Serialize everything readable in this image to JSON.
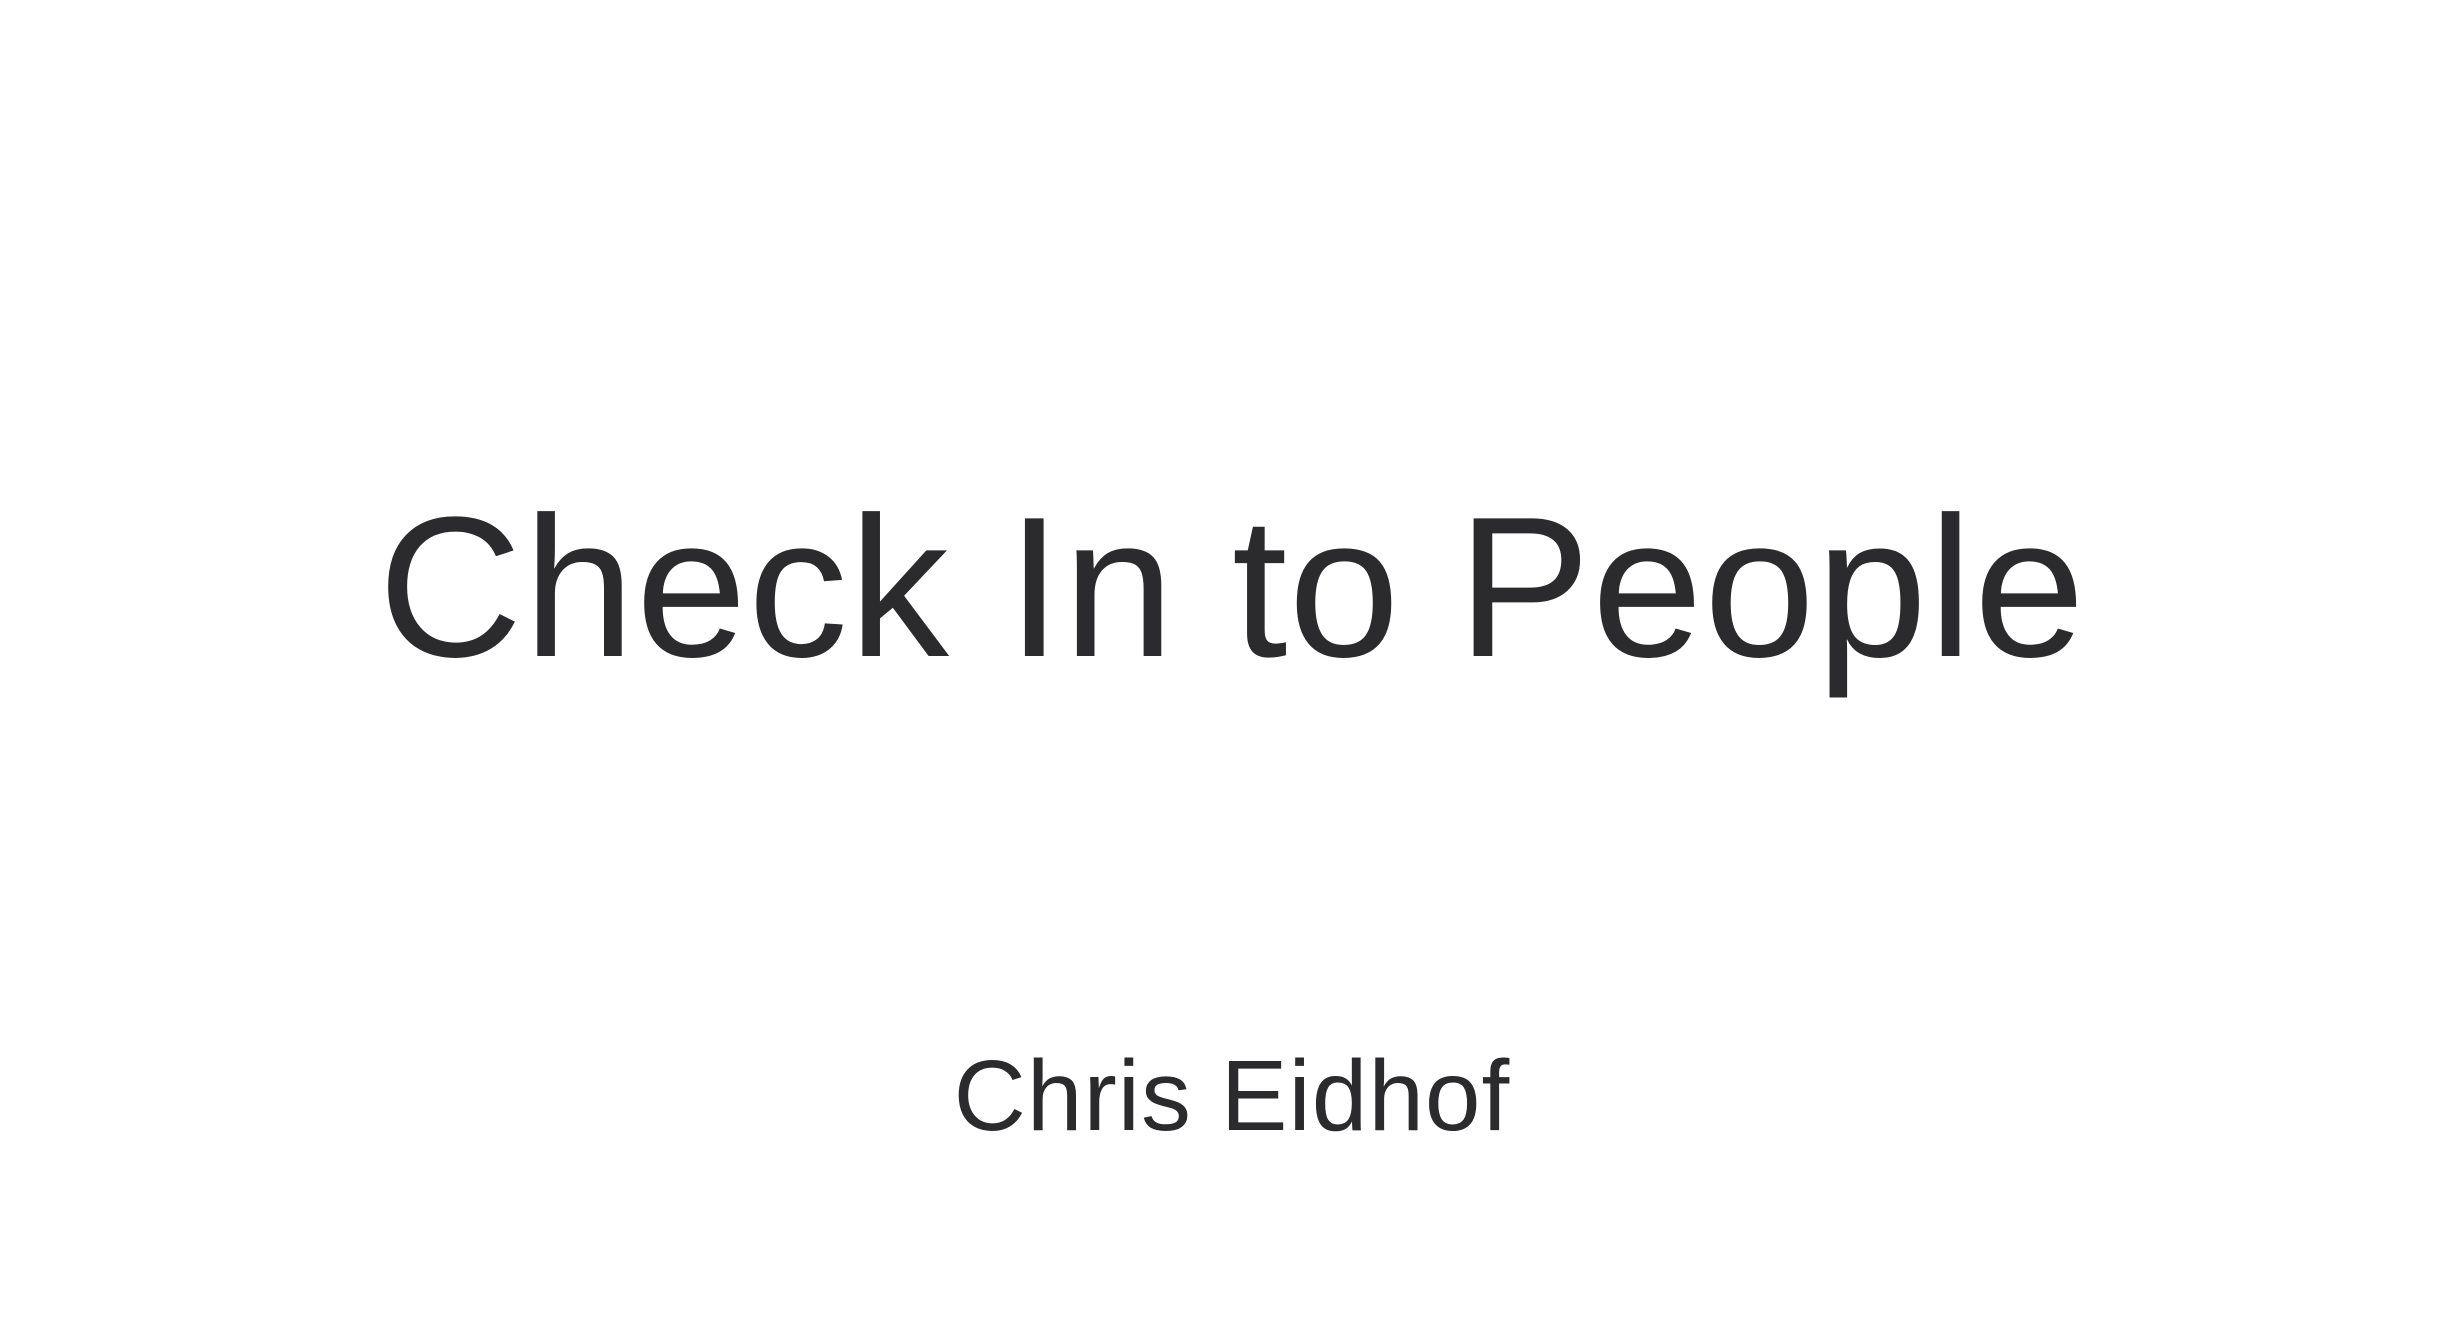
{
  "slide": {
    "title": "Check In to People",
    "author": "Chris Eidhof"
  },
  "colors": {
    "background": "#ffffff",
    "text": "#2b2b2d"
  }
}
